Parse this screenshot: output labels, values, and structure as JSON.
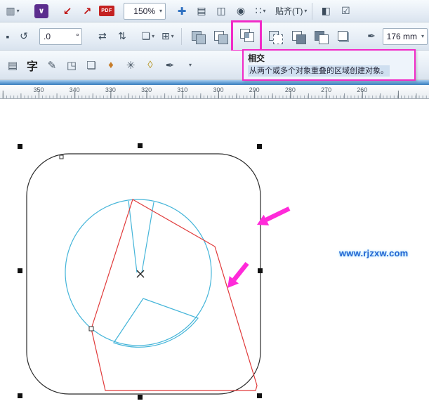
{
  "colors": {
    "magenta": "#f12bc7",
    "arrow": "#ff2ad9",
    "cyan": "#45b5d9",
    "red": "#e03a3a",
    "link": "#2767d2"
  },
  "icons": {
    "caret": "▾",
    "print_merge": "▥",
    "launcher": "∨",
    "import": "↙",
    "export": "↗",
    "pdf": "PDF",
    "pan": "✚",
    "ruler": "▤",
    "page": "◫",
    "eye": "◉",
    "dots": "∷",
    "welcome": "◧",
    "options": "☑",
    "lock": "▪",
    "rotate": "↺",
    "mirror_h": "⇄",
    "mirror_v": "⇅",
    "order": "❏",
    "align": "⊞",
    "pen": "✒"
  },
  "toolbar": {
    "zoom_level": "150%",
    "snap_label": "贴齐(T)"
  },
  "property_bar": {
    "angle_value": ".0",
    "angle_unit": "°",
    "outline_width": "176 mm"
  },
  "toolbox": {
    "icons": [
      "▤",
      "字",
      "✎",
      "◳",
      "❏",
      "♦",
      "✳",
      "◊",
      "✒"
    ]
  },
  "tooltip": {
    "title": "相交",
    "description": "从两个或多个对象重叠的区域创建对象。"
  },
  "ruler": {
    "labels": [
      "350",
      "340",
      "330",
      "320",
      "310",
      "300",
      "290",
      "280",
      "270",
      "260"
    ]
  },
  "canvas": {
    "watermark": "www.rjzxw.com"
  }
}
